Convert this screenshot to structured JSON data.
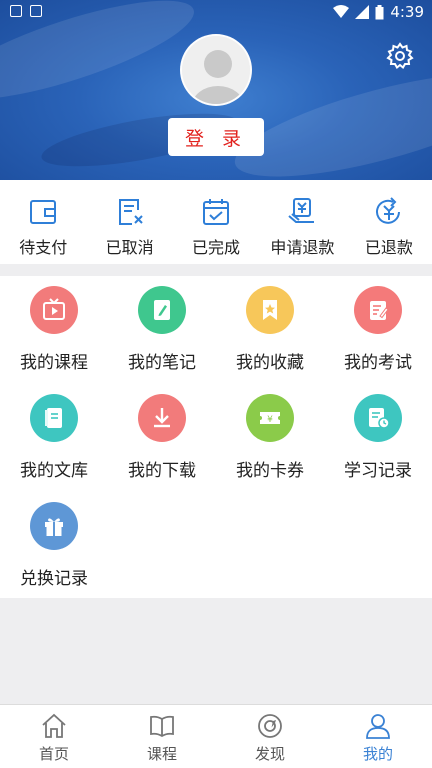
{
  "status_bar": {
    "time": "4:39"
  },
  "header": {
    "login_label": "登 录"
  },
  "orders": [
    {
      "label": "待支付",
      "icon": "wallet-icon"
    },
    {
      "label": "已取消",
      "icon": "cancelled-doc-icon"
    },
    {
      "label": "已完成",
      "icon": "calendar-check-icon"
    },
    {
      "label": "申请退款",
      "icon": "refund-request-icon"
    },
    {
      "label": "已退款",
      "icon": "refunded-icon"
    }
  ],
  "menu": [
    {
      "label": "我的课程",
      "icon": "play-tv-icon",
      "color": "#f27b7b"
    },
    {
      "label": "我的笔记",
      "icon": "notebook-icon",
      "color": "#3fc78e"
    },
    {
      "label": "我的收藏",
      "icon": "bookmark-star-icon",
      "color": "#f7c75a"
    },
    {
      "label": "我的考试",
      "icon": "exam-icon",
      "color": "#f47a7a"
    },
    {
      "label": "我的文库",
      "icon": "library-icon",
      "color": "#3ec6c0"
    },
    {
      "label": "我的下载",
      "icon": "download-icon",
      "color": "#f27b7b"
    },
    {
      "label": "我的卡券",
      "icon": "coupon-icon",
      "color": "#8bcb4a"
    },
    {
      "label": "学习记录",
      "icon": "study-record-icon",
      "color": "#3ec6c0"
    },
    {
      "label": "兑换记录",
      "icon": "gift-icon",
      "color": "#5e97d6"
    }
  ],
  "nav": [
    {
      "label": "首页",
      "icon": "home-icon"
    },
    {
      "label": "课程",
      "icon": "book-icon"
    },
    {
      "label": "发现",
      "icon": "compass-icon"
    },
    {
      "label": "我的",
      "icon": "user-icon",
      "active": true
    }
  ],
  "colors": {
    "accent": "#3b82d4",
    "order_icon": "#2f7fd8",
    "login_text": "#e2221e"
  }
}
